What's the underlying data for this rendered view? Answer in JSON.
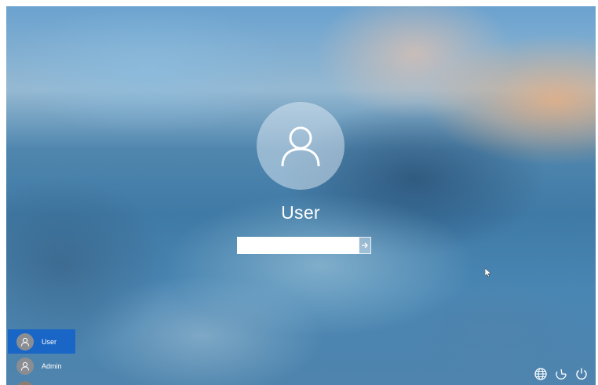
{
  "login": {
    "username": "User",
    "password_value": "",
    "password_placeholder": ""
  },
  "icons": {
    "avatar": "user-icon",
    "submit": "arrow-right-icon",
    "network": "globe-icon",
    "ease_of_access": "accessibility-icon",
    "power": "power-icon"
  },
  "user_list": {
    "items": [
      {
        "label": "User",
        "selected": true
      },
      {
        "label": "Admin",
        "selected": false
      }
    ]
  },
  "colors": {
    "selected_user": "#1a66c7"
  }
}
